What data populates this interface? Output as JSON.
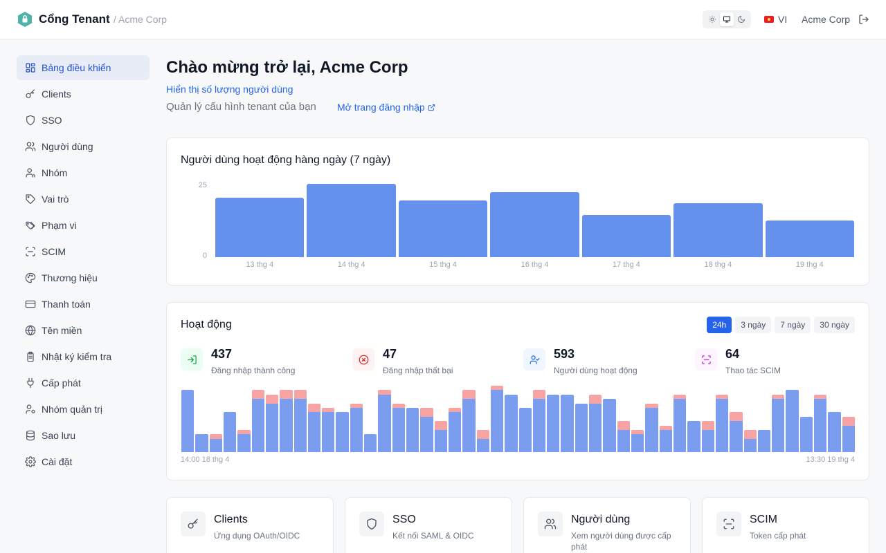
{
  "header": {
    "app_title": "Cổng Tenant",
    "breadcrumb": "/ Acme Corp",
    "language": "VI",
    "org_name": "Acme Corp"
  },
  "sidebar": {
    "items": [
      {
        "label": "Bảng điều khiển",
        "icon": "dashboard-icon",
        "active": true
      },
      {
        "label": "Clients",
        "icon": "key-icon"
      },
      {
        "label": "SSO",
        "icon": "shield-icon"
      },
      {
        "label": "Người dùng",
        "icon": "users-icon"
      },
      {
        "label": "Nhóm",
        "icon": "group-icon"
      },
      {
        "label": "Vai trò",
        "icon": "tag-icon"
      },
      {
        "label": "Phạm vi",
        "icon": "tags-icon"
      },
      {
        "label": "SCIM",
        "icon": "scan-icon"
      },
      {
        "label": "Thương hiệu",
        "icon": "palette-icon"
      },
      {
        "label": "Thanh toán",
        "icon": "credit-card-icon"
      },
      {
        "label": "Tên miền",
        "icon": "globe-icon"
      },
      {
        "label": "Nhật ký kiểm tra",
        "icon": "clipboard-icon"
      },
      {
        "label": "Cấp phát",
        "icon": "plug-icon"
      },
      {
        "label": "Nhóm quản trị",
        "icon": "admin-users-icon"
      },
      {
        "label": "Sao lưu",
        "icon": "database-icon"
      },
      {
        "label": "Cài đặt",
        "icon": "gear-icon"
      }
    ]
  },
  "main": {
    "title": "Chào mừng trở lại, Acme Corp",
    "show_users_link": "Hiển thị số lượng người dùng",
    "subtitle": "Quản lý cấu hình tenant của bạn",
    "login_link": "Mở trang đăng nhập"
  },
  "daily_card": {
    "title": "Người dùng hoạt động hàng ngày (7 ngày)"
  },
  "chart_data": {
    "type": "bar",
    "categories": [
      "13 thg 4",
      "14 thg 4",
      "15 thg 4",
      "16 thg 4",
      "17 thg 4",
      "18 thg 4",
      "19 thg 4"
    ],
    "values": [
      21,
      26,
      20,
      23,
      15,
      19,
      13
    ],
    "yticks": [
      "25",
      "0"
    ],
    "ylim": [
      0,
      25
    ],
    "color": "#6490ee"
  },
  "activity": {
    "title": "Hoạt động",
    "ranges": [
      {
        "label": "24h",
        "active": true
      },
      {
        "label": "3 ngày"
      },
      {
        "label": "7 ngày"
      },
      {
        "label": "30 ngày"
      }
    ],
    "stats": [
      {
        "value": "437",
        "label": "Đăng nhập thành công",
        "icon": "login-icon",
        "color": "#16a34a",
        "bg": "#ecfdf3"
      },
      {
        "value": "47",
        "label": "Đăng nhập thất bại",
        "icon": "x-circle-icon",
        "color": "#dc2626",
        "bg": "#fef2f2"
      },
      {
        "value": "593",
        "label": "Người dùng hoạt động",
        "icon": "user-check-icon",
        "color": "#2563eb",
        "bg": "#eff6ff"
      },
      {
        "value": "64",
        "label": "Thao tác SCIM",
        "icon": "scan-icon",
        "color": "#c026d3",
        "bg": "#fdf4ff"
      }
    ],
    "start_label": "14:00 18 thg 4",
    "end_label": "13:30 19 thg 4",
    "success_color": "#7b9df0",
    "failure_color": "#f8a3a3",
    "bars": [
      [
        14,
        0
      ],
      [
        4,
        0
      ],
      [
        3,
        1
      ],
      [
        9,
        0
      ],
      [
        4,
        1
      ],
      [
        12,
        2
      ],
      [
        11,
        2
      ],
      [
        12,
        2
      ],
      [
        12,
        2
      ],
      [
        9,
        2
      ],
      [
        9,
        1
      ],
      [
        9,
        0
      ],
      [
        10,
        1
      ],
      [
        4,
        0
      ],
      [
        13,
        1
      ],
      [
        10,
        1
      ],
      [
        10,
        0
      ],
      [
        8,
        2
      ],
      [
        5,
        2
      ],
      [
        9,
        1
      ],
      [
        12,
        2
      ],
      [
        3,
        2
      ],
      [
        14,
        1
      ],
      [
        13,
        0
      ],
      [
        10,
        0
      ],
      [
        12,
        2
      ],
      [
        13,
        0
      ],
      [
        13,
        0
      ],
      [
        11,
        0
      ],
      [
        11,
        2
      ],
      [
        12,
        0
      ],
      [
        5,
        2
      ],
      [
        4,
        1
      ],
      [
        10,
        1
      ],
      [
        5,
        1
      ],
      [
        12,
        1
      ],
      [
        7,
        0
      ],
      [
        5,
        2
      ],
      [
        12,
        1
      ],
      [
        7,
        2
      ],
      [
        3,
        2
      ],
      [
        5,
        0
      ],
      [
        12,
        1
      ],
      [
        14,
        0
      ],
      [
        8,
        0
      ],
      [
        12,
        1
      ],
      [
        9,
        0
      ],
      [
        6,
        2
      ]
    ],
    "bar_max": 15
  },
  "quick_cards": [
    {
      "title": "Clients",
      "desc": "Ứng dụng OAuth/OIDC",
      "icon": "key-icon"
    },
    {
      "title": "SSO",
      "desc": "Kết nối SAML & OIDC",
      "icon": "shield-icon"
    },
    {
      "title": "Người dùng",
      "desc": "Xem người dùng được cấp phát",
      "icon": "users-icon"
    },
    {
      "title": "SCIM",
      "desc": "Token cấp phát",
      "icon": "scan-icon"
    }
  ]
}
